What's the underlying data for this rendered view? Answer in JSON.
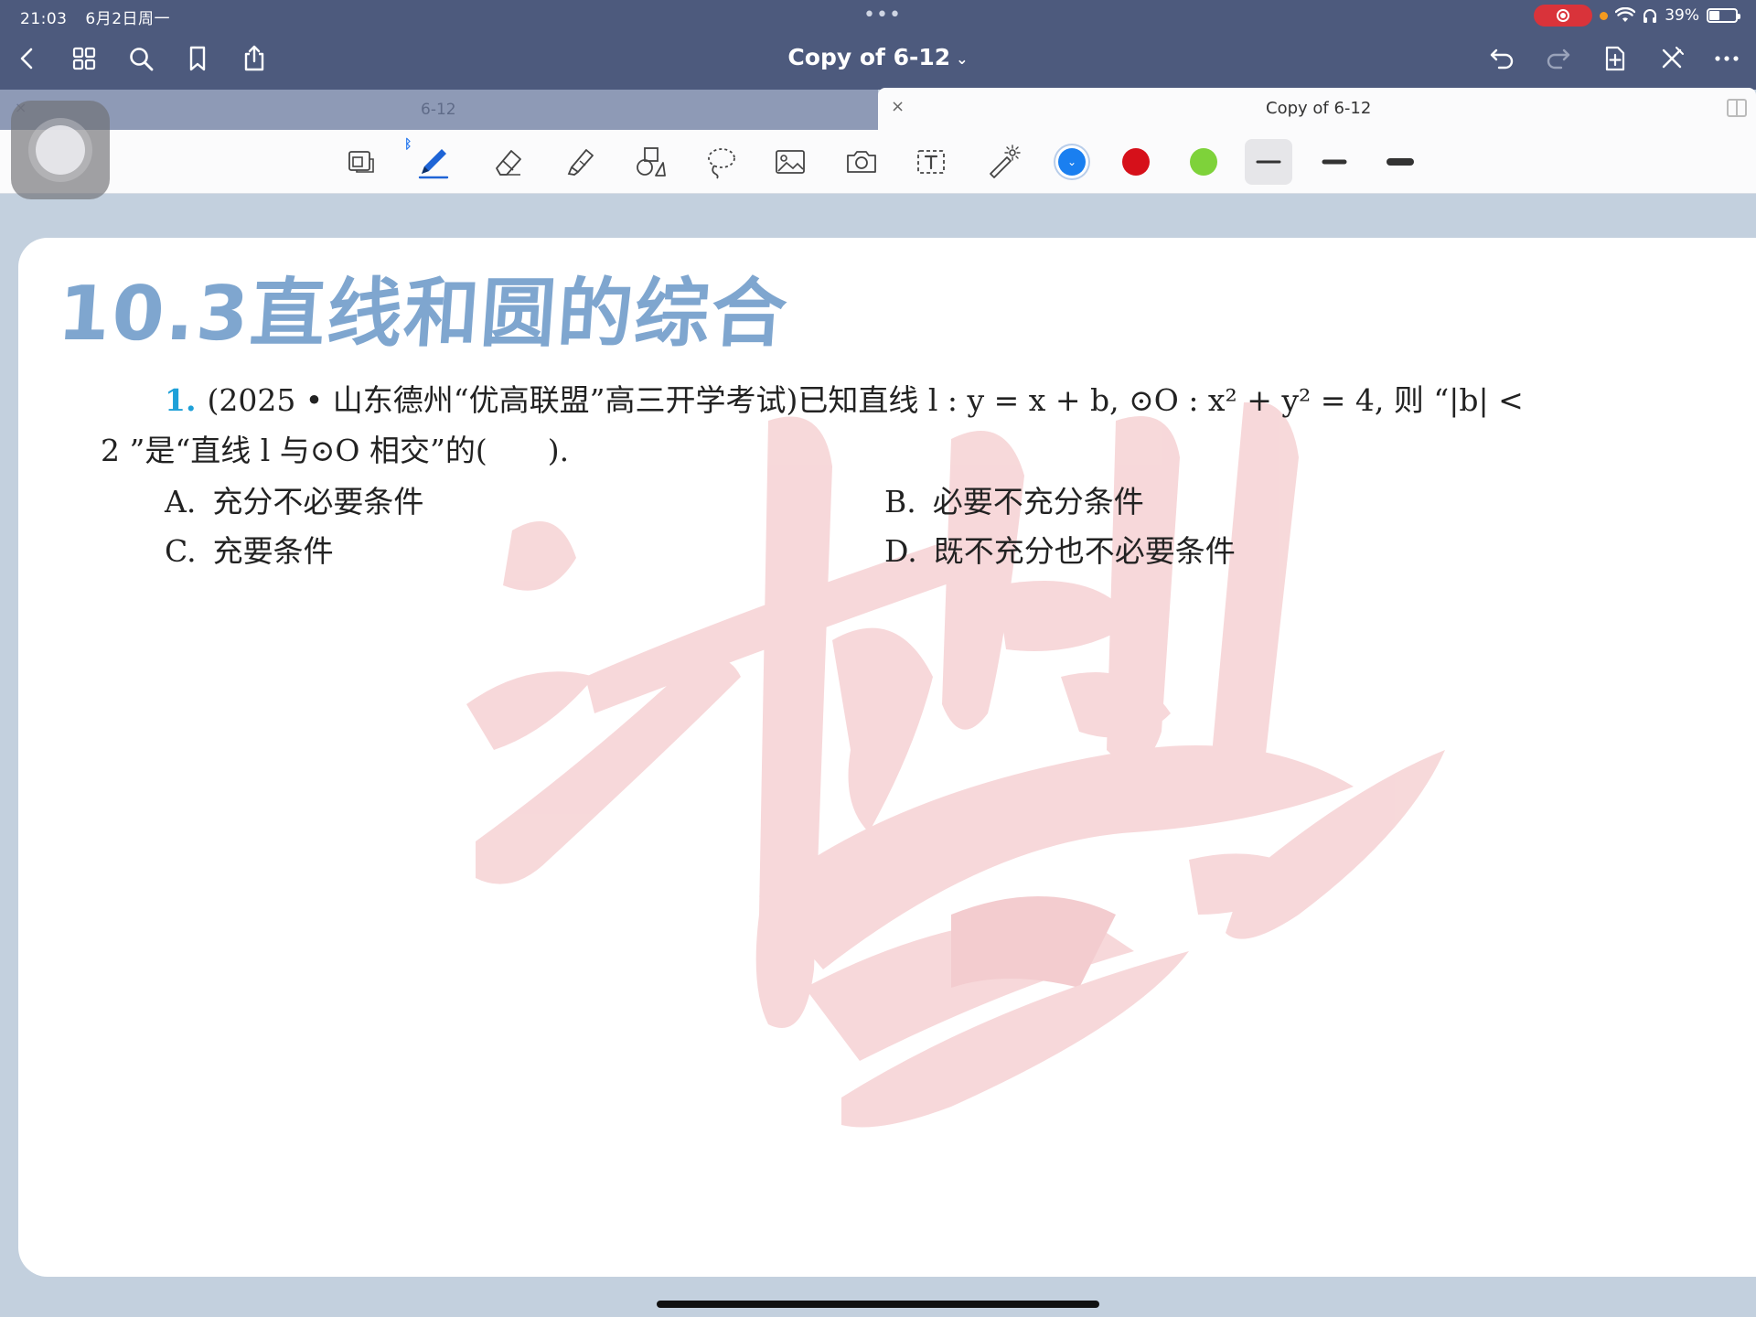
{
  "status_bar": {
    "time": "21:03",
    "date": "6月2日周一",
    "battery": "39%",
    "battery_fraction": 0.39
  },
  "nav": {
    "title": "Copy of 6-12",
    "title_chevron": "⌄"
  },
  "tabs": [
    {
      "label": "6-12",
      "close": "×"
    },
    {
      "label": "Copy of 6-12",
      "close": "×"
    }
  ],
  "toolbar": {
    "colors": {
      "blue": "#1a7ff0",
      "red": "#d6101a",
      "green": "#7ed23a"
    }
  },
  "document": {
    "section_title": "10.3直线和圆的综合",
    "question": {
      "number": "1.",
      "line1": "(2025 • 山东德州“优高联盟”高三开学考试)已知直线 l : y = x + b, ⊙O : x² + y² = 4, 则 “|b| <",
      "line2": "2 ”是“直线 l 与⊙O 相交”的(　　).",
      "options": [
        {
          "key": "A.",
          "text": "充分不必要条件"
        },
        {
          "key": "B.",
          "text": "必要不充分条件"
        },
        {
          "key": "C.",
          "text": "充要条件"
        },
        {
          "key": "D.",
          "text": "既不充分也不必要条件"
        }
      ]
    }
  }
}
